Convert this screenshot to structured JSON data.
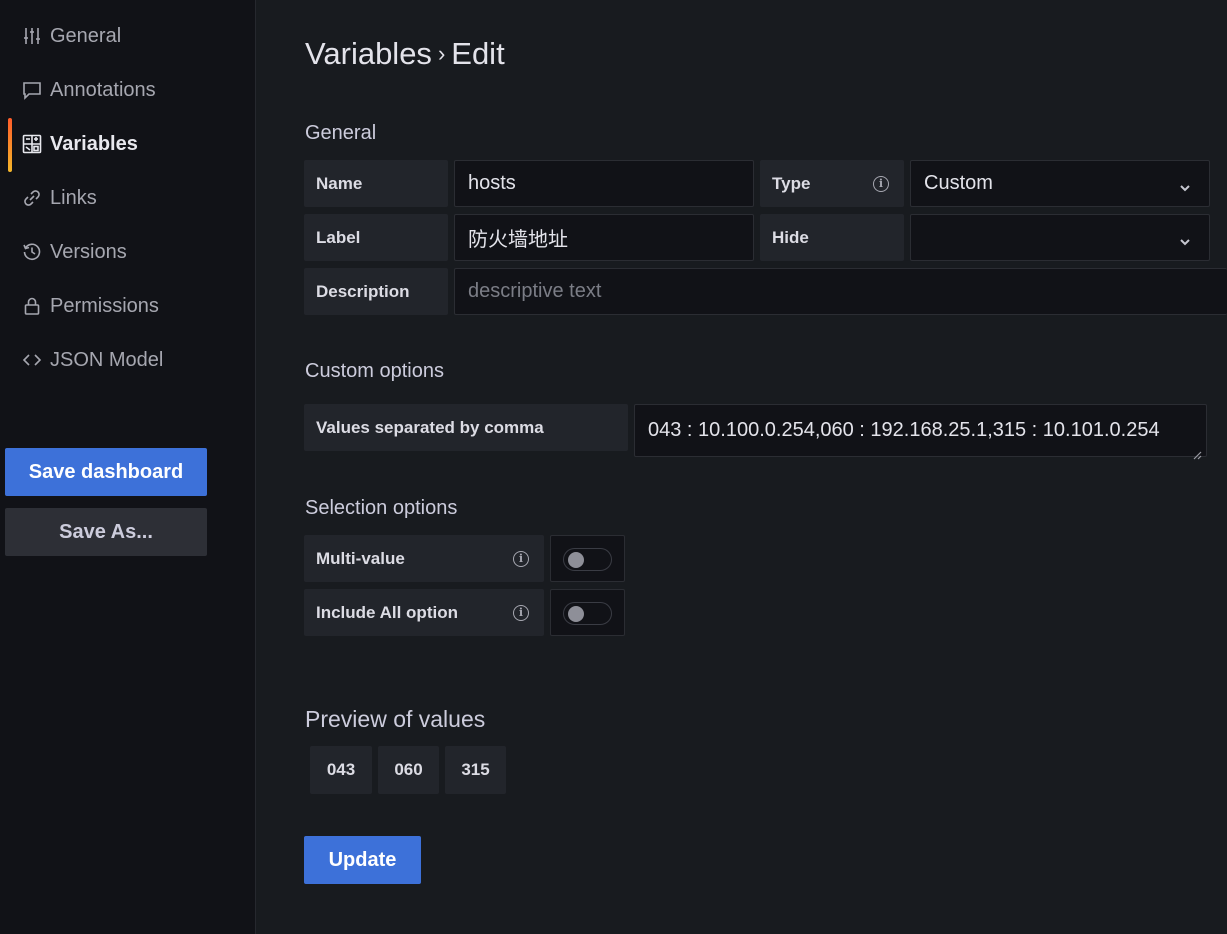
{
  "sidebar": {
    "items": [
      {
        "label": "General",
        "icon": "sliders-icon"
      },
      {
        "label": "Annotations",
        "icon": "comment-icon"
      },
      {
        "label": "Variables",
        "icon": "variables-grid-icon",
        "active": true
      },
      {
        "label": "Links",
        "icon": "link-icon"
      },
      {
        "label": "Versions",
        "icon": "history-icon"
      },
      {
        "label": "Permissions",
        "icon": "lock-icon"
      },
      {
        "label": "JSON Model",
        "icon": "code-brackets-icon"
      }
    ],
    "save_label": "Save dashboard",
    "save_as_label": "Save As..."
  },
  "page": {
    "title_parent": "Variables",
    "title_separator": "›",
    "title_current": "Edit"
  },
  "general": {
    "heading": "General",
    "name_label": "Name",
    "name_value": "hosts",
    "type_label": "Type",
    "type_value": "Custom",
    "label_label": "Label",
    "label_value": "防火墙地址",
    "hide_label": "Hide",
    "hide_value": "",
    "description_label": "Description",
    "description_placeholder": "descriptive text"
  },
  "custom_options": {
    "heading": "Custom options",
    "values_label": "Values separated by comma",
    "values_value": "043 : 10.100.0.254,060 : 192.168.25.1,315 : 10.101.0.254"
  },
  "selection_options": {
    "heading": "Selection options",
    "multi_value_label": "Multi-value",
    "multi_value_on": false,
    "include_all_label": "Include All option",
    "include_all_on": false
  },
  "preview": {
    "heading": "Preview of values",
    "values": [
      "043",
      "060",
      "315"
    ]
  },
  "update_label": "Update",
  "colors": {
    "accent_blue": "#3d71d9",
    "active_bar_top": "#ff5c2a",
    "active_bar_bottom": "#f5b72a",
    "background": "#181b1f",
    "sidebar_background": "#111217"
  }
}
